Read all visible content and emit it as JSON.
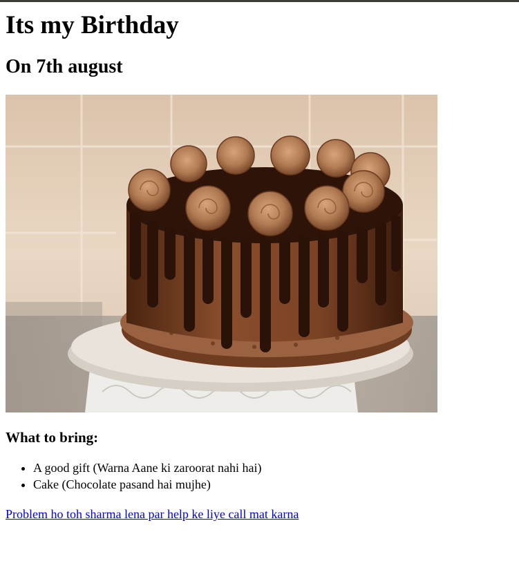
{
  "page": {
    "title": "Its my Birthday",
    "subtitle": "On 7th august",
    "bring_heading": "What to bring:",
    "bring_items": [
      "A good gift (Warna Aane ki zaroorat nahi hai)",
      "Cake (Chocolate pasand hai mujhe)"
    ],
    "help_link": "Problem ho toh sharma lena par help ke liye call mat karna"
  },
  "image": {
    "subject": "chocolate-drip-cake",
    "colors": {
      "wall": "#e6d2bd",
      "ganache": "#3a1a0c",
      "frosting": "#b07a52",
      "stand": "#e8e6e2"
    }
  }
}
